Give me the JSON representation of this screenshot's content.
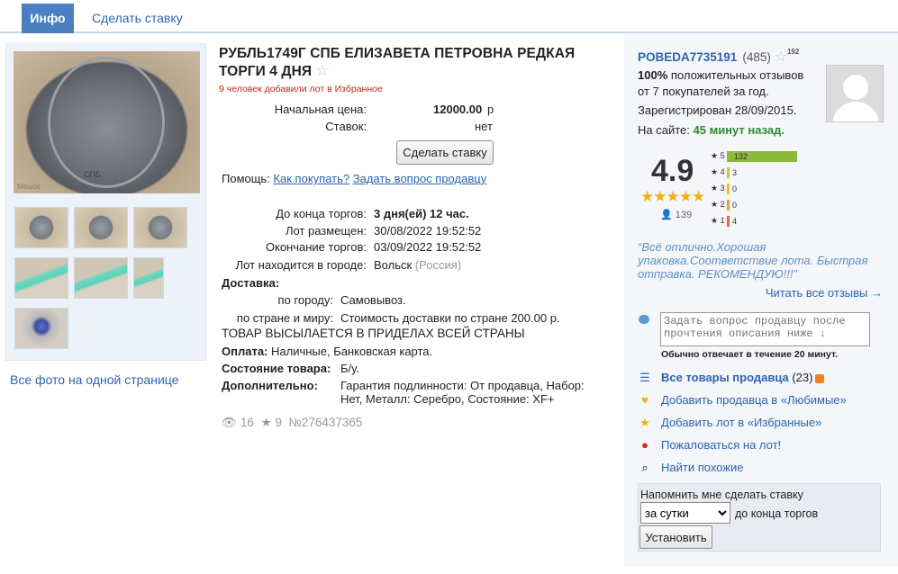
{
  "tabs": {
    "info": "Инфо",
    "bid": "Сделать ставку"
  },
  "photos": {
    "watermark": "Мешок",
    "coin_legend": "СПБ",
    "all_photos_link": "Все фото на одной странице"
  },
  "lot": {
    "title": "РУБЛЬ1749Г СПБ ЕЛИЗАВЕТА ПЕТРОВНА РЕДКАЯ ТОРГИ 4 ДНЯ",
    "favorites_note": "9 человек добавили лот в Избранное",
    "start_price_label": "Начальная цена:",
    "start_price": "12000.00",
    "currency": "р",
    "bids_label": "Ставок:",
    "bids": "нет",
    "bid_button": "Сделать ставку",
    "help_label": "Помощь:",
    "help_how": "Как покупать?",
    "help_ask": "Задать вопрос продавцу",
    "ends_in_label": "До конца торгов:",
    "ends_in": "3 дня(ей) 12 час.",
    "posted_label": "Лот размещен:",
    "posted": "30/08/2022 19:52:52",
    "end_label": "Окончание торгов:",
    "end": "03/09/2022 19:52:52",
    "city_label": "Лот находится в городе:",
    "city": "Вольск",
    "country": "(Россия)",
    "delivery_label": "Доставка:",
    "city_delivery_label": "по городу:",
    "city_delivery": "Самовывоз.",
    "world_delivery_label": "по стране и миру:",
    "world_delivery": "Стоимость доставки по стране 200.00 р.",
    "ship_note": "ТОВАР ВЫСЫЛАЕТСЯ В ПРИДЕЛАХ ВСЕЙ СТРАНЫ",
    "payment_label": "Оплата:",
    "payment": "Наличные, Банковская карта.",
    "condition_label": "Состояние товара:",
    "condition": "Б/у.",
    "extra_label": "Дополнительно:",
    "extra_line1": "Гарантия подлинности: От продавца, Набор:",
    "extra_line2": "Нет, Металл: Серебро, Состояние: XF+",
    "views": "16",
    "stars": "9",
    "lot_number": "№276437365"
  },
  "seller": {
    "name": "POBEDA7735191",
    "score": "(485)",
    "sup": "192",
    "positive_pct": "100%",
    "positive_text": "положительных отзывов",
    "from_line": "от 7 покупателей за год.",
    "registered": "Зарегистрирован 28/09/2015.",
    "online_label": "На сайте:",
    "online_value": "45 минут назад.",
    "rating": "4.9",
    "rating_stars": "★★★★★",
    "review_count": "139",
    "quote": "“Всё отлично.Хорошая упаковка.Соответствие лота. Быстрая отправка. РЕКОМЕНДУЮ!!!”",
    "read_all": "Читать все отзывы →"
  },
  "rating_bars": [
    {
      "label": "★ 5",
      "value": 132,
      "color": "#8db83a"
    },
    {
      "label": "★ 4",
      "value": 3,
      "color": "#c2cc2a"
    },
    {
      "label": "★ 3",
      "value": 0,
      "color": "#e6c51b"
    },
    {
      "label": "★ 2",
      "value": 0,
      "color": "#f0a02a"
    },
    {
      "label": "★ 1",
      "value": 4,
      "color": "#ec6a2c"
    }
  ],
  "actions": {
    "ask_placeholder": "Задать вопрос продавцу после прочтения описания ниже ↓",
    "ask_note": "Обычно отвечает в течение 20 минут.",
    "all_goods": "Все товары продавца",
    "all_goods_count": "(23)",
    "add_seller_fav": "Добавить продавца в «Любимые»",
    "add_lot_fav": "Добавить лот в «Избранные»",
    "complain": "Пожаловаться на лот!",
    "find_similar": "Найти похожие"
  },
  "remind": {
    "title": "Напомнить мне сделать ставку",
    "selected": "за сутки",
    "after": "до конца торгов",
    "button": "Установить"
  },
  "colors": {
    "accent": "#4a7fc1",
    "link": "#2b64b0",
    "online": "#2e8b2e",
    "alert": "#c0271f"
  }
}
